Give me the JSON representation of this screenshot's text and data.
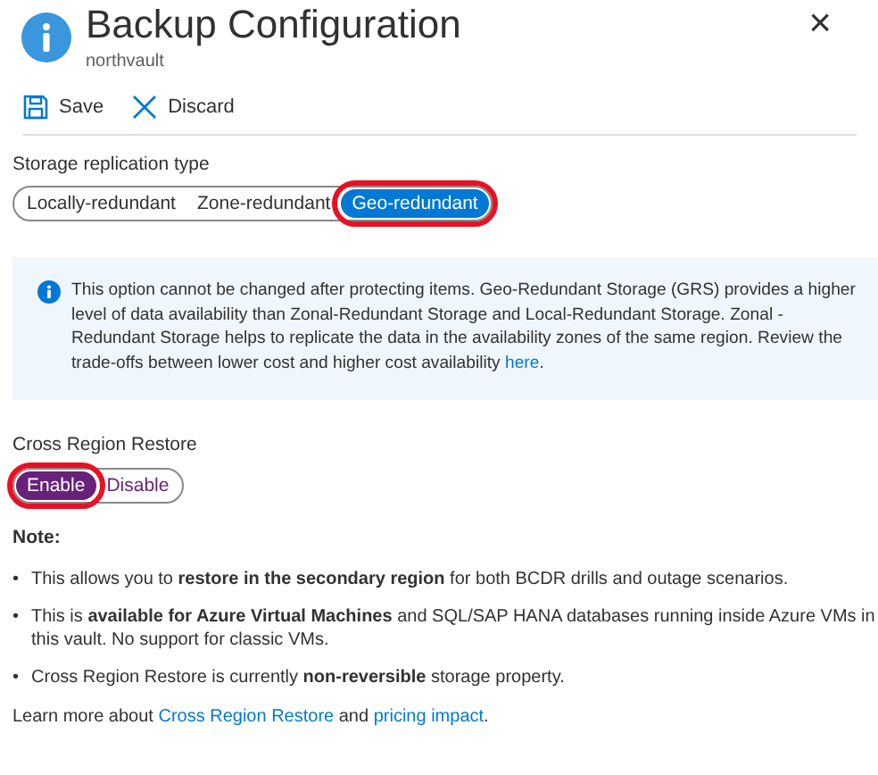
{
  "header": {
    "title": "Backup Configuration",
    "subtitle": "northvault",
    "close": "×"
  },
  "toolbar": [
    {
      "kind": "save",
      "label": "Save"
    },
    {
      "kind": "discard",
      "label": "Discard"
    }
  ],
  "replication": {
    "label": "Storage replication type",
    "options": [
      {
        "label": "Locally-redundant",
        "selected": false,
        "highlighted": false
      },
      {
        "label": "Zone-redundant",
        "selected": false,
        "highlighted": false
      },
      {
        "label": "Geo-redundant",
        "selected": true,
        "highlighted": true
      }
    ]
  },
  "info": {
    "text": "This option cannot be changed after protecting items. Geo-Redundant Storage (GRS) provides a higher level of data availability than Zonal-Redundant Storage and Local-Redundant Storage. Zonal -Redundant Storage helps to replicate the data in the availability zones of the same region. Review the trade-offs between lower cost and higher cost availability ",
    "link": "here",
    "end": "."
  },
  "cross_region": {
    "label": "Cross Region Restore",
    "options": [
      {
        "label": "Enable",
        "selected": true,
        "highlighted": true
      },
      {
        "label": "Disable",
        "selected": false,
        "highlighted": false
      }
    ]
  },
  "note": {
    "title": "Note:",
    "bullets": [
      {
        "marker": "•",
        "text": "This allows you to **restore in the secondary region** for both BCDR drills and outage scenarios."
      },
      {
        "marker": "•",
        "text": "This is **available for Azure Virtual Machines** and SQL/SAP HANA databases running inside Azure VMs in this vault. No support for classic VMs."
      },
      {
        "marker": "•",
        "text": "Cross Region Restore is currently **non-reversible** storage property."
      }
    ]
  },
  "learn_more": {
    "text": "Learn more about ",
    "link1": "Cross Region Restore",
    "middle": " and ",
    "link2": "pricing impact",
    "end": "."
  }
}
